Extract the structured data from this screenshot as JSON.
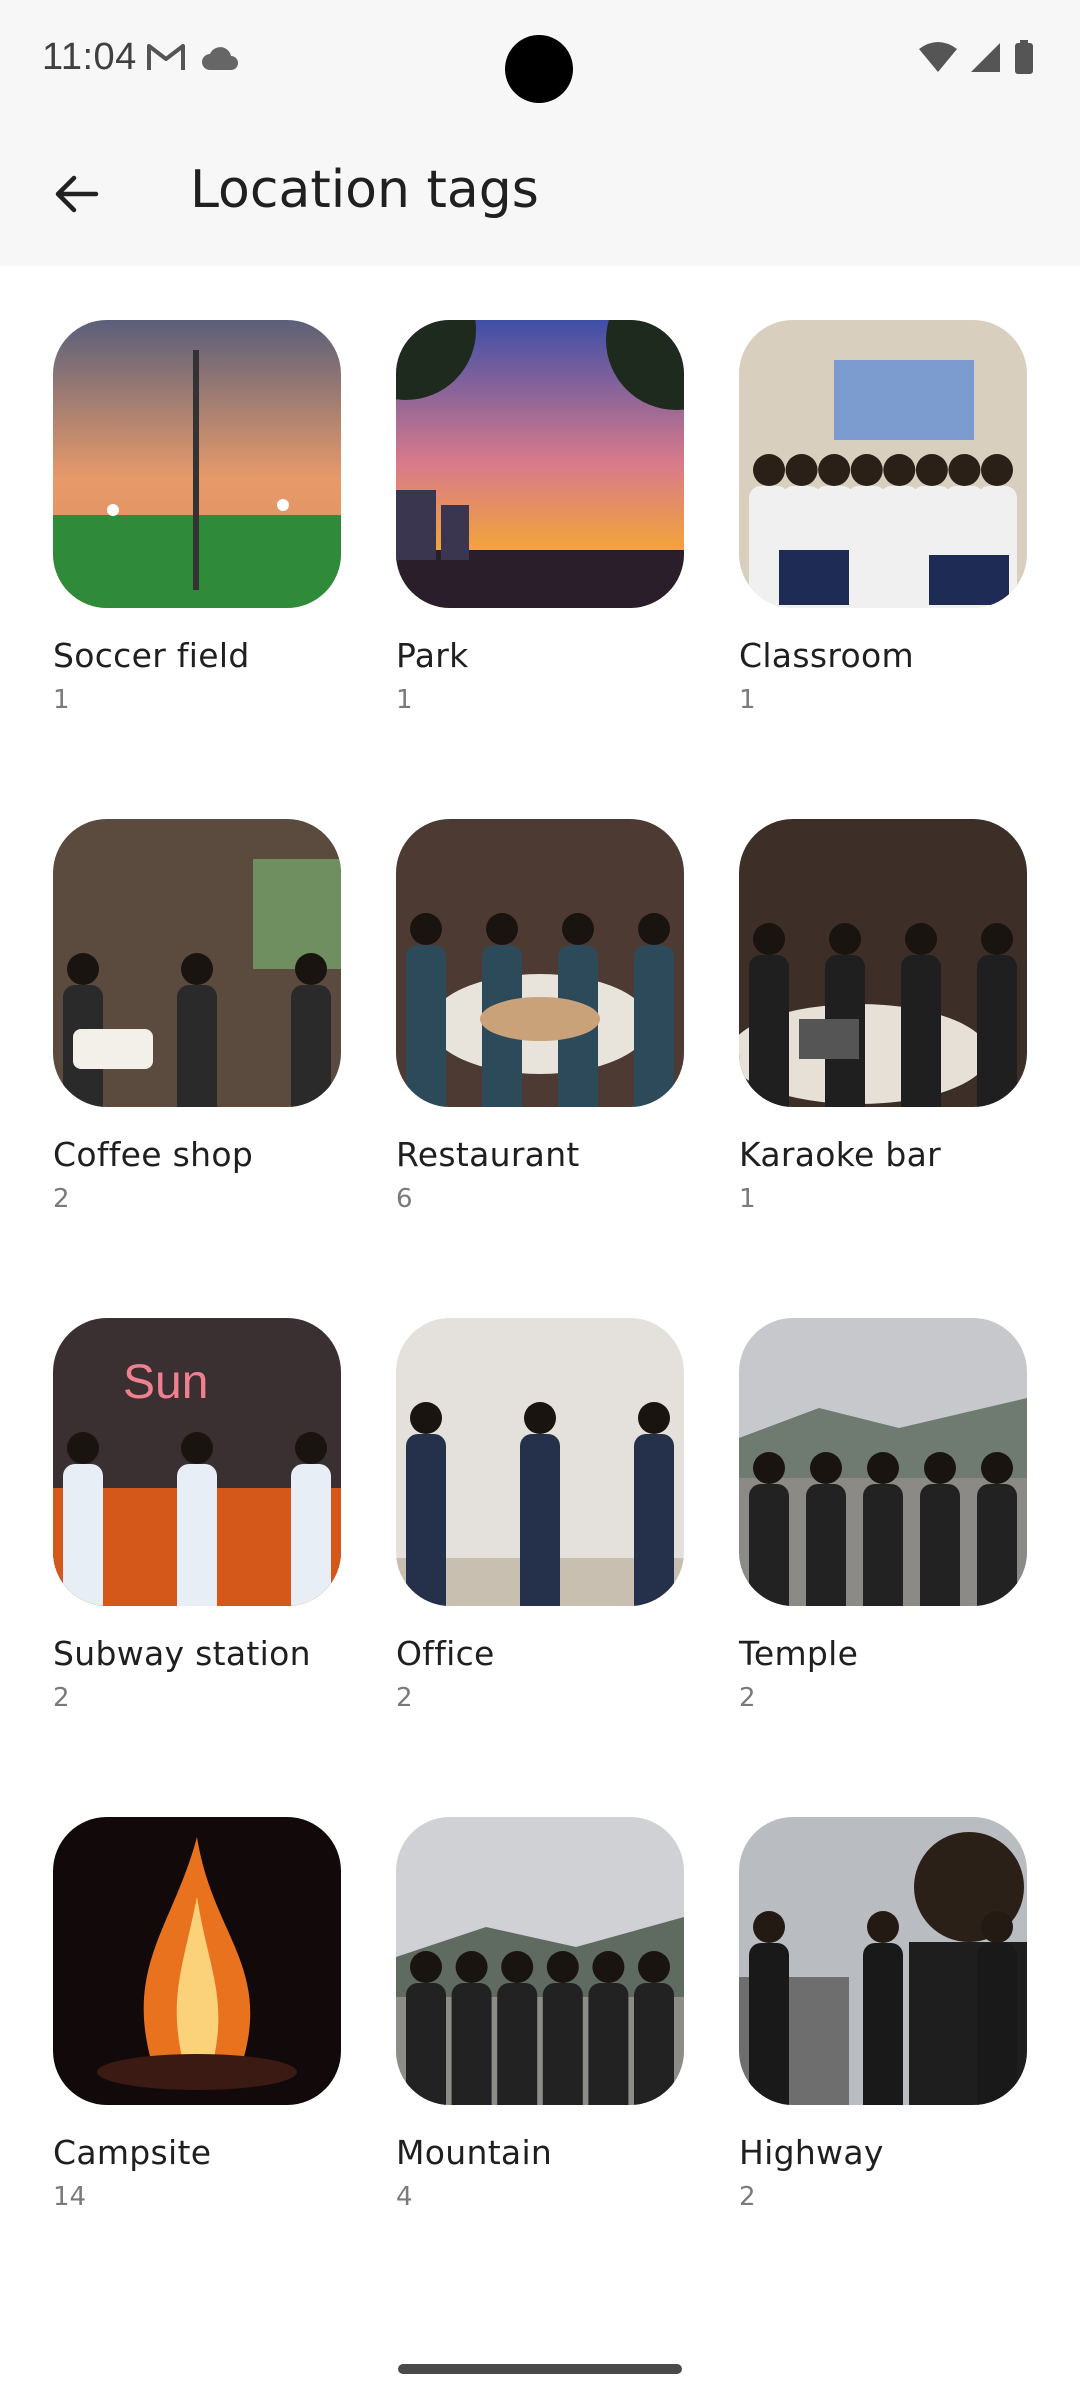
{
  "status_bar": {
    "time": "11:04",
    "icons": [
      "gmail-icon",
      "cloud-icon",
      "wifi-icon",
      "signal-icon",
      "battery-icon"
    ]
  },
  "app_bar": {
    "title": "Location tags",
    "back_icon": "arrow-left-icon"
  },
  "tags": [
    {
      "label": "Soccer field",
      "count": "1",
      "scene": "soccer"
    },
    {
      "label": "Park",
      "count": "1",
      "scene": "sunset"
    },
    {
      "label": "Classroom",
      "count": "1",
      "scene": "classroom"
    },
    {
      "label": "Coffee shop",
      "count": "2",
      "scene": "coffee"
    },
    {
      "label": "Restaurant",
      "count": "6",
      "scene": "restaurant"
    },
    {
      "label": "Karaoke bar",
      "count": "1",
      "scene": "karaoke"
    },
    {
      "label": "Subway station",
      "count": "2",
      "scene": "subway"
    },
    {
      "label": "Office",
      "count": "2",
      "scene": "office"
    },
    {
      "label": "Temple",
      "count": "2",
      "scene": "temple"
    },
    {
      "label": "Campsite",
      "count": "14",
      "scene": "campfire"
    },
    {
      "label": "Mountain",
      "count": "4",
      "scene": "mountain"
    },
    {
      "label": "Highway",
      "count": "2",
      "scene": "highway"
    }
  ],
  "colors": {
    "app_bar_bg": "#f7f7f7",
    "text_primary": "#1f1f1f",
    "text_secondary": "#7a7a7a"
  }
}
